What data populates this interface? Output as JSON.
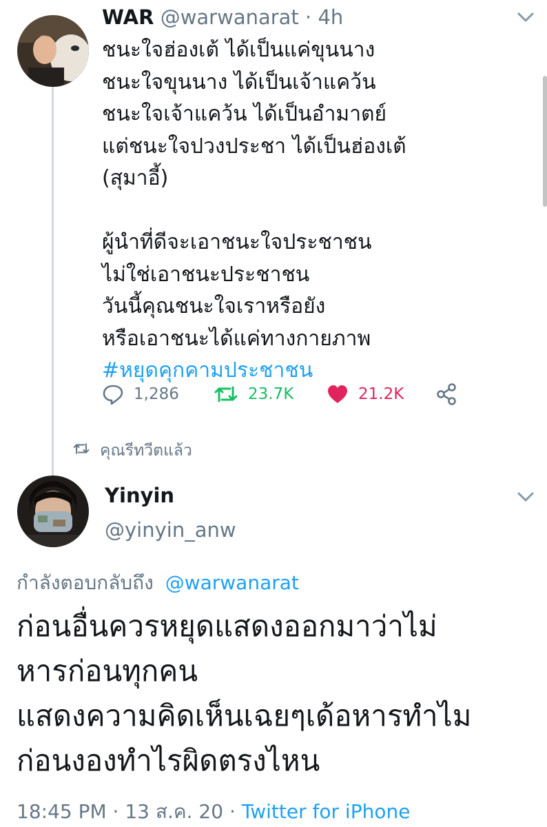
{
  "colors": {
    "accent": "#1da1f2",
    "muted": "#657786",
    "text": "#14171a",
    "retweet_green": "#17bf63",
    "like_red": "#e0245e"
  },
  "tweet1": {
    "author_name": "WAR",
    "handle": "@warwanarat",
    "separator": "·",
    "time": "4h",
    "lines": [
      "ชนะใจฮ่องเต้ ได้เป็นแค่ขุนนาง",
      "ชนะใจขุนนาง ได้เป็นเจ้าแคว้น",
      "ชนะใจเจ้าแคว้น ได้เป็นอำมาตย์",
      "แต่ชนะใจปวงประชา ได้เป็นฮ่องเต้",
      "(สุมาอี้)",
      "ผู้นำที่ดีจะเอาชนะใจประชาชน",
      "ไม่ใช่เอาชนะประชาชน",
      "วันนี้คุณชนะใจเราหรือยัง",
      "หรือเอาชนะได้แค่ทางกายภาพ"
    ],
    "hashtag": "#หยุดคุกคามประชาชน",
    "replies": "1,286",
    "retweets": "23.7K",
    "likes": "21.2K",
    "icons": [
      "reply-icon",
      "retweet-icon",
      "heart-icon",
      "share-icon",
      "chevron-down-icon"
    ]
  },
  "retweeted_label": "คุณรีทวีตแล้ว",
  "tweet2": {
    "author_name": "Yinyin",
    "handle": "@yinyin_anw",
    "replying_to_label": "กำลังตอบกลับถึง",
    "replying_to_handle": "@warwanarat",
    "lines": [
      "ก่อนอื่นควรหยุดแสดงออกมาว่าไม่",
      "หารก่อนทุกคน",
      "แสดงความคิดเห็นเฉยๆเด้อหารทำไม",
      "ก่อนงองทำไรผิดตรงไหน"
    ],
    "time": "18:45 PM",
    "separator": "·",
    "date": "13 ส.ค. 20",
    "source": "Twitter for iPhone"
  }
}
